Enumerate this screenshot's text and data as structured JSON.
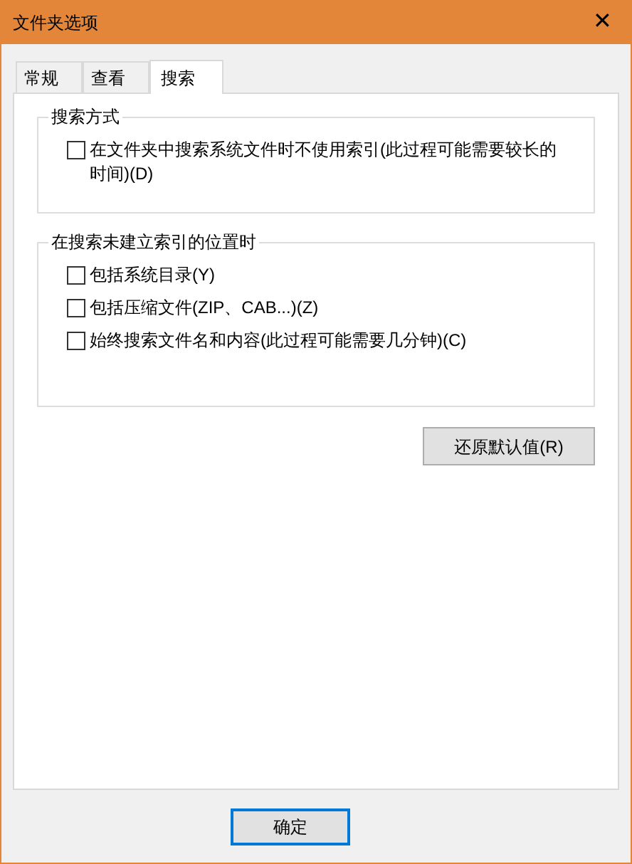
{
  "window": {
    "title": "文件夹选项",
    "close": "✕"
  },
  "tabs": [
    {
      "label": "常规",
      "selected": false
    },
    {
      "label": "查看",
      "selected": false
    },
    {
      "label": "搜索",
      "selected": true
    }
  ],
  "groups": [
    {
      "title": "搜索方式",
      "options": [
        {
          "label": "在文件夹中搜索系统文件时不使用索引(此过程可能需要较长的时间)(D)",
          "checked": false
        }
      ]
    },
    {
      "title": "在搜索未建立索引的位置时",
      "options": [
        {
          "label": "包括系统目录(Y)",
          "checked": false
        },
        {
          "label": "包括压缩文件(ZIP、CAB...)(Z)",
          "checked": false
        },
        {
          "label": "始终搜索文件名和内容(此过程可能需要几分钟)(C)",
          "checked": false
        }
      ]
    }
  ],
  "restore_button": "还原默认值(R)",
  "buttons": [
    {
      "label": "确定",
      "focused": true
    }
  ]
}
